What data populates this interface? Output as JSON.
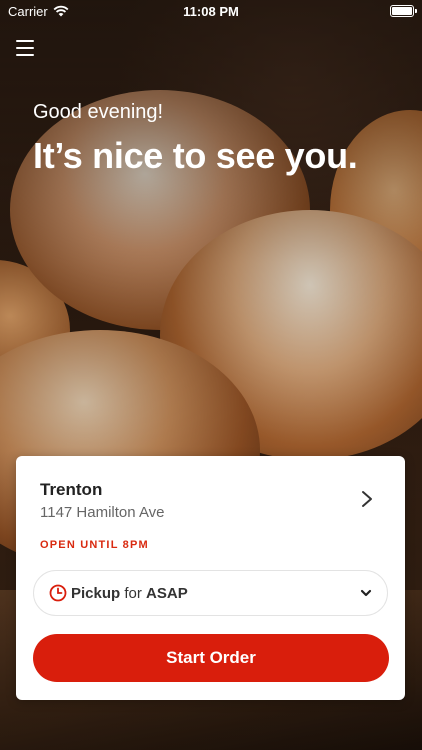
{
  "status_bar": {
    "carrier": "Carrier",
    "time": "11:08 PM"
  },
  "header": {
    "greeting": "Good evening!",
    "headline": "It’s nice to see you."
  },
  "store": {
    "name": "Trenton",
    "address": "1147 Hamilton Ave",
    "hours": "OPEN UNTIL 8PM"
  },
  "order_mode": {
    "method": "Pickup",
    "connector": "for",
    "time": "ASAP"
  },
  "actions": {
    "start_order": "Start Order"
  },
  "colors": {
    "accent": "#d91e0c",
    "hours_text": "#d92a10"
  },
  "icons": {
    "menu": "hamburger-menu-icon",
    "chevron": "chevron-right-icon",
    "clock": "clock-icon",
    "dropdown": "chevron-down-icon"
  }
}
